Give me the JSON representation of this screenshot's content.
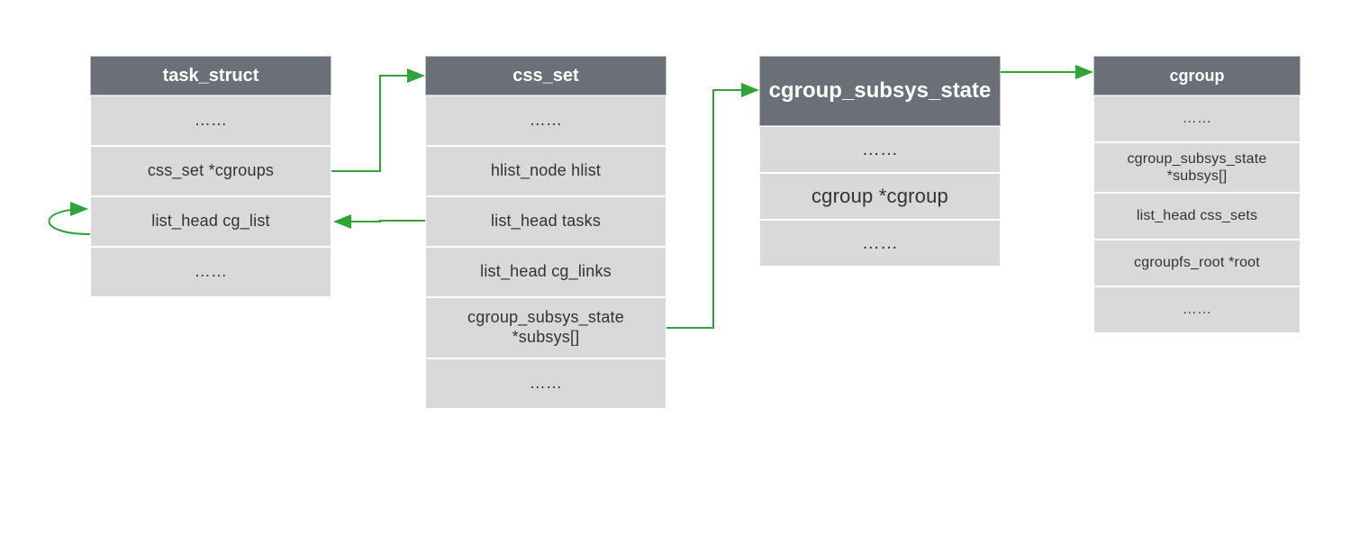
{
  "colors": {
    "header_bg": "#6a6f78",
    "header_text": "#ffffff",
    "row_bg": "#d9d9d9",
    "row_text": "#333333",
    "arrow": "#2fa43a"
  },
  "structs": {
    "task_struct": {
      "title": "task_struct",
      "rows": [
        "……",
        "css_set *cgroups",
        "list_head cg_list",
        "……"
      ]
    },
    "css_set": {
      "title": "css_set",
      "rows": [
        "……",
        "hlist_node hlist",
        "list_head tasks",
        "list_head cg_links",
        "cgroup_subsys_state *subsys[]",
        "……"
      ]
    },
    "cgroup_subsys_state": {
      "title": "cgroup_subsys_state",
      "rows": [
        "……",
        "cgroup *cgroup",
        "……"
      ]
    },
    "cgroup": {
      "title": "cgroup",
      "rows": [
        "……",
        "cgroup_subsys_state *subsys[]",
        "list_head css_sets",
        "cgroupfs_root *root",
        "……"
      ]
    }
  },
  "arrows": [
    {
      "name": "task.cgroups -> css_set",
      "from": "task_struct.css_set *cgroups",
      "to": "css_set"
    },
    {
      "name": "css_set.tasks -> task.cg_list",
      "from": "css_set.list_head tasks",
      "to": "task_struct.list_head cg_list"
    },
    {
      "name": "task.cg_list self-loop",
      "from": "task_struct.list_head cg_list",
      "to": "task_struct.list_head cg_list"
    },
    {
      "name": "css_set.subsys -> cgroup_subsys_state",
      "from": "css_set.cgroup_subsys_state *subsys[]",
      "to": "cgroup_subsys_state"
    },
    {
      "name": "cgroup_subsys_state -> cgroup",
      "from": "cgroup_subsys_state",
      "to": "cgroup"
    }
  ]
}
